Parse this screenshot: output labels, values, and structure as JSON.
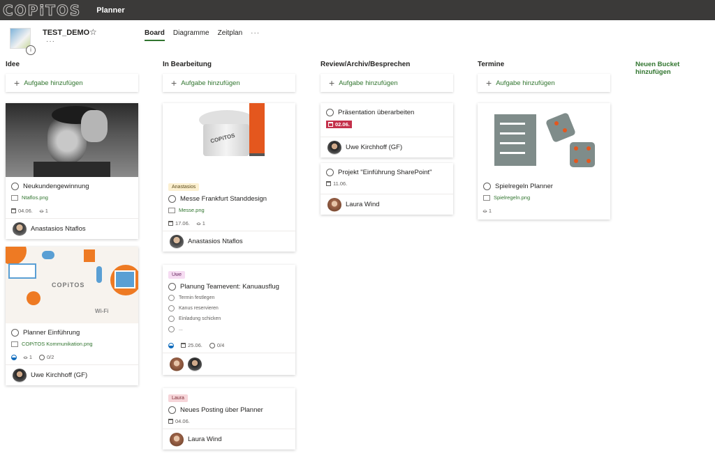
{
  "app": {
    "logo": "COPiTOS",
    "name": "Planner"
  },
  "plan": {
    "title": "TEST_DEMO",
    "more": "···"
  },
  "tabs": [
    {
      "label": "Board"
    },
    {
      "label": "Diagramme"
    },
    {
      "label": "Zeitplan"
    }
  ],
  "tabs_more": "···",
  "add_task_label": "Aufgabe hinzufügen",
  "new_bucket_label": "Neuen Bucket hinzufügen",
  "buckets": [
    {
      "title": "Idee"
    },
    {
      "title": "In Bearbeitung"
    },
    {
      "title": "Review/Archiv/Besprechen"
    },
    {
      "title": "Termine"
    }
  ],
  "cards": {
    "neukunden": {
      "title": "Neukundengewinnung",
      "attachment": "Ntaflos.png",
      "date": "04.06.",
      "attachments": "1",
      "assignee": "Anastasios Ntaflos"
    },
    "einfuehrung": {
      "title": "Planner Einführung",
      "attachment": "COPiTOS Kommunikation.png",
      "attachments": "1",
      "checklist": "0/2",
      "assignee": "Uwe Kirchhoff (GF)",
      "image_logo": "COPiTOS",
      "image_wifi": "Wi-Fi"
    },
    "messe": {
      "label": "Anastasios",
      "title": "Messe Frankfurt Standdesign",
      "attachment": "Messe.png",
      "date": "17.06.",
      "attachments": "1",
      "assignee": "Anastasios Ntaflos",
      "image_logo": "COPiTOS"
    },
    "teamevent": {
      "label": "Uwe",
      "title": "Planung Teamevent: Kanuausflug",
      "items": [
        "Termin festlegen",
        "Kanus reservieren",
        "Einladung schicken",
        "..."
      ],
      "date": "25.06.",
      "checklist": "0/4"
    },
    "posting": {
      "label": "Laura",
      "title": "Neues Posting über Planner",
      "date": "04.06.",
      "assignee": "Laura Wind"
    },
    "praesentation": {
      "title": "Präsentation überarbeiten",
      "date": "02.06.",
      "assignee": "Uwe Kirchhoff (GF)"
    },
    "sharepoint": {
      "title": "Projekt \"Einführung SharePoint\"",
      "date": "11.06.",
      "assignee": "Laura Wind"
    },
    "spielregeln": {
      "title": "Spielregeln Planner",
      "attachment": "Spielregeln.png",
      "attachments": "1"
    }
  },
  "colors": {
    "accent": "#31752f",
    "topbar": "#3b3a39",
    "overdue": "#c4314b",
    "label_anastasios": "#fcf0d0",
    "label_uwe": "#f6dcf2",
    "label_laura": "#f6d5d9"
  }
}
